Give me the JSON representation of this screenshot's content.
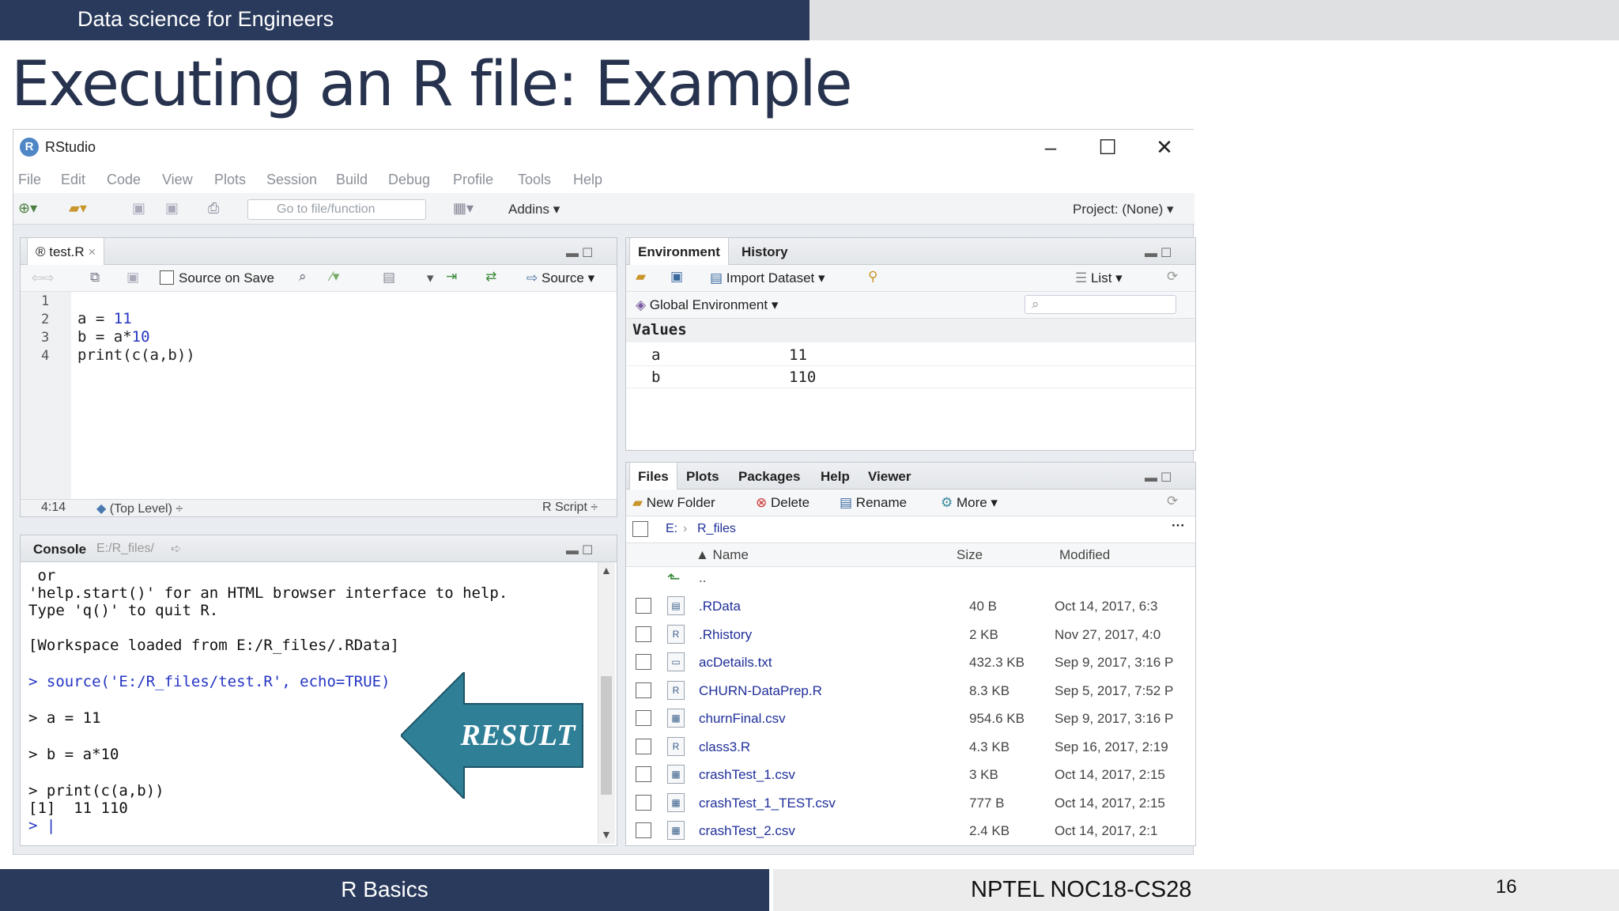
{
  "slide": {
    "header_text": "Data science for Engineers",
    "title": "Executing an R file: Example",
    "footer_left": "R Basics",
    "footer_center": "NPTEL NOC18-CS28",
    "page_number": "16"
  },
  "window": {
    "title": "RStudio",
    "logo_letter": "R",
    "minimize": "–",
    "maximize": "☐",
    "close": "✕"
  },
  "menu": [
    "File",
    "Edit",
    "Code",
    "View",
    "Plots",
    "Session",
    "Build",
    "Debug",
    "Profile",
    "Tools",
    "Help"
  ],
  "toolbar": {
    "goto_placeholder": "Go to file/function",
    "addins": "Addins ▾",
    "project": "Project: (None) ▾"
  },
  "source": {
    "tab": "test.R",
    "source_on_save": "Source on Save",
    "source_button": "Source",
    "lines": [
      {
        "n": "1",
        "code": ""
      },
      {
        "n": "2",
        "pre": "a = ",
        "num": "11",
        "post": ""
      },
      {
        "n": "3",
        "pre": "b = a*",
        "num": "10",
        "post": ""
      },
      {
        "n": "4",
        "pre": "print(c(a,b))",
        "num": "",
        "post": ""
      }
    ],
    "status_pos": "4:14",
    "status_scope": "(Top Level) ÷",
    "status_type": "R Script ÷"
  },
  "console": {
    "tab": "Console",
    "path": "E:/R_files/",
    "lines": [
      {
        "text": " or",
        "cmd": false
      },
      {
        "text": "'help.start()' for an HTML browser interface to help.",
        "cmd": false
      },
      {
        "text": "Type 'q()' to quit R.",
        "cmd": false
      },
      {
        "text": "[Workspace loaded from E:/R_files/.RData]",
        "cmd": false
      },
      {
        "text": "> source('E:/R_files/test.R', echo=TRUE)",
        "cmd": true
      },
      {
        "text": "> a = 11",
        "cmd": false
      },
      {
        "text": "> b = a*10",
        "cmd": false
      },
      {
        "text": "> print(c(a,b))",
        "cmd": false
      },
      {
        "text": "[1]  11 110",
        "cmd": false
      },
      {
        "text": "> |",
        "cmd": true
      }
    ]
  },
  "result_label": "RESULT",
  "environment": {
    "tabs": [
      "Environment",
      "History"
    ],
    "import_dataset": "Import Dataset ▾",
    "list_view": "List ▾",
    "scope": "Global Environment ▾",
    "values_header": "Values",
    "rows": [
      {
        "name": "a",
        "value": "11"
      },
      {
        "name": "b",
        "value": "110"
      }
    ]
  },
  "files": {
    "tabs": [
      "Files",
      "Plots",
      "Packages",
      "Help",
      "Viewer"
    ],
    "new_folder": "New Folder",
    "delete": "Delete",
    "rename": "Rename",
    "more": "More ▾",
    "path_root": "E:",
    "path_folder": "R_files",
    "col_name": "▲ Name",
    "col_size": "Size",
    "col_modified": "Modified",
    "parent": "..",
    "rows": [
      {
        "name": ".RData",
        "size": "40 B",
        "modified": "Oct 14, 2017, 6:3"
      },
      {
        "name": ".Rhistory",
        "size": "2 KB",
        "modified": "Nov 27, 2017, 4:0"
      },
      {
        "name": "acDetails.txt",
        "size": "432.3 KB",
        "modified": "Sep 9, 2017, 3:16 P"
      },
      {
        "name": "CHURN-DataPrep.R",
        "size": "8.3 KB",
        "modified": "Sep 5, 2017, 7:52 P"
      },
      {
        "name": "churnFinal.csv",
        "size": "954.6 KB",
        "modified": "Sep 9, 2017, 3:16 P"
      },
      {
        "name": "class3.R",
        "size": "4.3 KB",
        "modified": "Sep 16, 2017, 2:19"
      },
      {
        "name": "crashTest_1.csv",
        "size": "3 KB",
        "modified": "Oct 14, 2017, 2:15"
      },
      {
        "name": "crashTest_1_TEST.csv",
        "size": "777 B",
        "modified": "Oct 14, 2017, 2:15"
      },
      {
        "name": "crashTest_2.csv",
        "size": "2.4 KB",
        "modified": "Oct 14, 2017, 2:1"
      }
    ]
  }
}
